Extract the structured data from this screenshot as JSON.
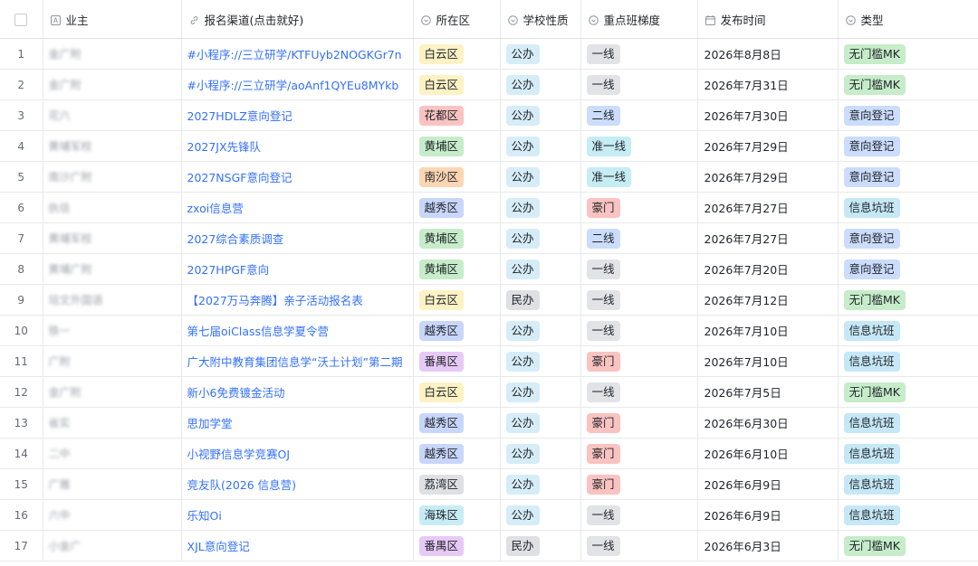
{
  "header": {
    "owner": "业主",
    "channel": "报名渠道(点击就好)",
    "district": "所在区",
    "school_type": "学校性质",
    "class_level": "重点班梯度",
    "publish_time": "发布时间",
    "category": "类型"
  },
  "header_icons": {
    "owner": "text-field-icon",
    "channel": "link-icon",
    "district": "single-select-icon",
    "school_type": "single-select-icon",
    "class_level": "single-select-icon",
    "publish_time": "calendar-icon",
    "category": "single-select-icon"
  },
  "tag_colors": {
    "白云区": "#fdf2c4",
    "花都区": "#f9c3c1",
    "黄埔区": "#c6ecc9",
    "南沙区": "#fcd6b3",
    "越秀区": "#c9d6fb",
    "番禺区": "#e7c9f6",
    "荔湾区": "#dee0e3",
    "海珠区": "#c6ecf4",
    "公办": "#d6edf8",
    "民办": "#dee0e3",
    "一线": "#e1e3e6",
    "二线": "#cbdcfc",
    "准一线": "#c6ecf4",
    "豪门": "#f9c3c1",
    "无门槛MK": "#c6ecc9",
    "意向登记": "#cbdcfc",
    "信息坑班": "#c6e8f6"
  },
  "rows": [
    {
      "num": "1",
      "owner": "金广附",
      "channel": "#小程序://三立研学/KTFUyb2NOGKGr7n",
      "district": "白云区",
      "school_type": "公办",
      "class_level": "一线",
      "date": "2026年8月8日",
      "category": "无门槛MK"
    },
    {
      "num": "2",
      "owner": "金广附",
      "channel": "#小程序://三立研学/aoAnf1QYEu8MYkb",
      "district": "白云区",
      "school_type": "公办",
      "class_level": "一线",
      "date": "2026年7月31日",
      "category": "无门槛MK"
    },
    {
      "num": "3",
      "owner": "花六",
      "channel": "2027HDLZ意向登记",
      "district": "花都区",
      "school_type": "公办",
      "class_level": "二线",
      "date": "2026年7月30日",
      "category": "意向登记"
    },
    {
      "num": "4",
      "owner": "黄埔军校",
      "channel": "2027JX先锋队",
      "district": "黄埔区",
      "school_type": "公办",
      "class_level": "准一线",
      "date": "2026年7月29日",
      "category": "意向登记"
    },
    {
      "num": "5",
      "owner": "南沙广附",
      "channel": "2027NSGF意向登记",
      "district": "南沙区",
      "school_type": "公办",
      "class_level": "准一线",
      "date": "2026年7月29日",
      "category": "意向登记"
    },
    {
      "num": "6",
      "owner": "执信",
      "channel": "zxoi信息营",
      "district": "越秀区",
      "school_type": "公办",
      "class_level": "豪门",
      "date": "2026年7月27日",
      "category": "信息坑班"
    },
    {
      "num": "7",
      "owner": "黄埔军校",
      "channel": "2027综合素质调查",
      "district": "黄埔区",
      "school_type": "公办",
      "class_level": "二线",
      "date": "2026年7月27日",
      "category": "意向登记"
    },
    {
      "num": "8",
      "owner": "黄埔广附",
      "channel": "2027HPGF意向",
      "district": "黄埔区",
      "school_type": "公办",
      "class_level": "一线",
      "date": "2026年7月20日",
      "category": "意向登记"
    },
    {
      "num": "9",
      "owner": "培文外国语",
      "channel": "【2027万马奔腾】亲子活动报名表",
      "district": "白云区",
      "school_type": "民办",
      "class_level": "一线",
      "date": "2026年7月12日",
      "category": "无门槛MK"
    },
    {
      "num": "10",
      "owner": "铁一",
      "channel": "第七届oiClass信息学夏令营",
      "district": "越秀区",
      "school_type": "公办",
      "class_level": "一线",
      "date": "2026年7月10日",
      "category": "信息坑班"
    },
    {
      "num": "11",
      "owner": "广附",
      "channel": "广大附中教育集团信息学“沃土计划”第二期",
      "district": "番禺区",
      "school_type": "公办",
      "class_level": "豪门",
      "date": "2026年7月10日",
      "category": "信息坑班"
    },
    {
      "num": "12",
      "owner": "金广附",
      "channel": "新小6免费镀金活动",
      "district": "白云区",
      "school_type": "公办",
      "class_level": "一线",
      "date": "2026年7月5日",
      "category": "无门槛MK"
    },
    {
      "num": "13",
      "owner": "省实",
      "channel": "思加学堂",
      "district": "越秀区",
      "school_type": "公办",
      "class_level": "豪门",
      "date": "2026年6月30日",
      "category": "信息坑班"
    },
    {
      "num": "14",
      "owner": "二中",
      "channel": "小视野信息学竞赛OJ",
      "district": "越秀区",
      "school_type": "公办",
      "class_level": "豪门",
      "date": "2026年6月10日",
      "category": "信息坑班"
    },
    {
      "num": "15",
      "owner": "广雅",
      "channel": "竞友队(2026 信息营)",
      "district": "荔湾区",
      "school_type": "公办",
      "class_level": "豪门",
      "date": "2026年6月9日",
      "category": "信息坑班"
    },
    {
      "num": "16",
      "owner": "六中",
      "channel": "乐知Oi",
      "district": "海珠区",
      "school_type": "公办",
      "class_level": "一线",
      "date": "2026年6月9日",
      "category": "信息坑班"
    },
    {
      "num": "17",
      "owner": "小金广",
      "channel": "XJL意向登记",
      "district": "番禺区",
      "school_type": "民办",
      "class_level": "一线",
      "date": "2026年6月3日",
      "category": "无门槛MK"
    }
  ]
}
